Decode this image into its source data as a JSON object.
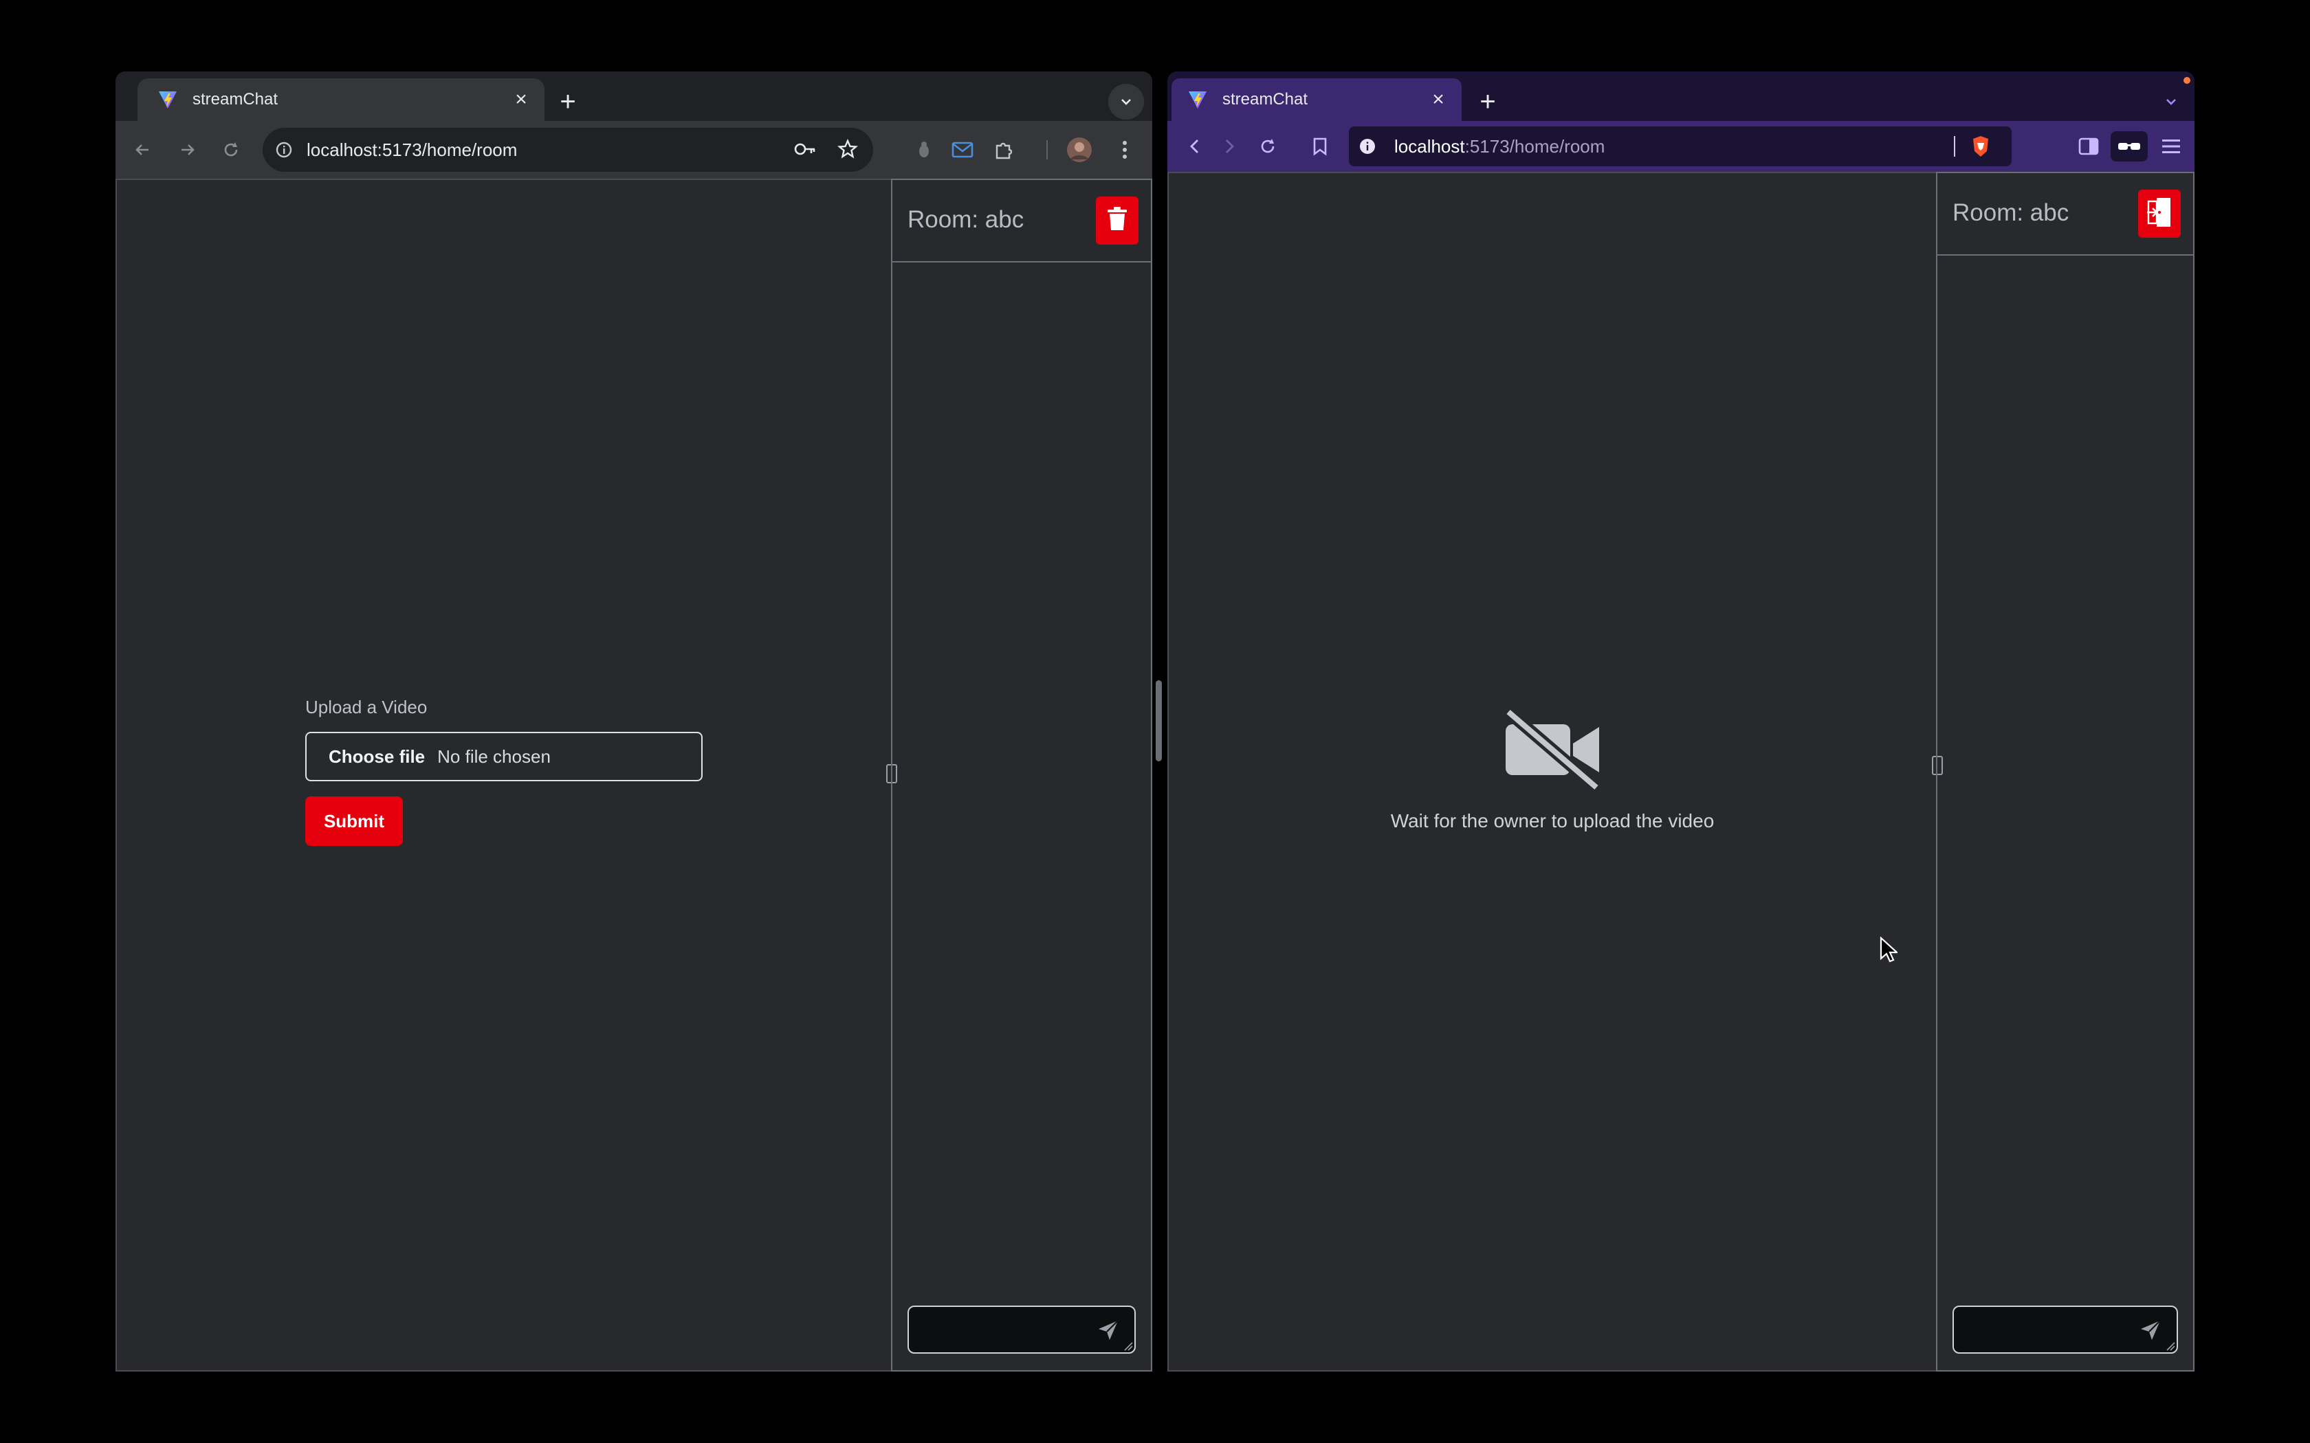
{
  "left_window": {
    "tab_title": "streamChat",
    "url": "localhost:5173/home/room",
    "room_title": "Room: abc",
    "upload_label": "Upload a Video",
    "file_button": "Choose file",
    "file_status": "No file chosen",
    "submit_label": "Submit",
    "chat_placeholder": ""
  },
  "right_window": {
    "tab_title": "streamChat",
    "url_host": "localhost",
    "url_rest": ":5173/home/room",
    "room_title": "Room: abc",
    "wait_message": "Wait for the owner to upload the video",
    "chat_placeholder": ""
  },
  "colors": {
    "accent_red": "#e6000e",
    "page_background": "#27292d",
    "brave_frame": "#1b1334"
  },
  "icons": [
    "vite-favicon",
    "close-icon",
    "plus-icon",
    "chevron-down-icon",
    "back-arrow-icon",
    "forward-arrow-icon",
    "reload-icon",
    "site-info-icon",
    "password-key-icon",
    "star-icon",
    "extension-icon",
    "mail-icon",
    "puzzle-icon",
    "avatar",
    "kebab-menu-icon",
    "trash-icon",
    "exit-door-icon",
    "send-icon",
    "video-off-icon",
    "bookmark-icon",
    "brave-shield-icon",
    "sidebar-icon",
    "reader-glasses-icon",
    "hamburger-menu-icon",
    "mouse-cursor"
  ]
}
